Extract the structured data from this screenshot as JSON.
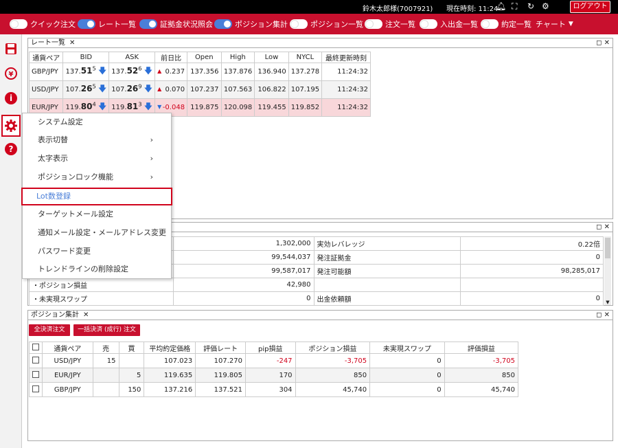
{
  "topbar": {
    "user": "鈴木太郎様(7007921)",
    "time": "現在時刻: 11:24",
    "logout": "ログアウト"
  },
  "menu": [
    {
      "label": "クイック注文",
      "on": false
    },
    {
      "label": "レート一覧",
      "on": true
    },
    {
      "label": "証拠金状況照会",
      "on": true
    },
    {
      "label": "ポジション集計",
      "on": true
    },
    {
      "label": "ポジション一覧",
      "on": false
    },
    {
      "label": "注文一覧",
      "on": false
    },
    {
      "label": "入出金一覧",
      "on": false
    },
    {
      "label": "約定一覧",
      "on": false
    }
  ],
  "chart_menu": "チャート",
  "rate_panel": {
    "title": "レート一覧",
    "headers": [
      "通貨ペア",
      "BID",
      "ASK",
      "前日比",
      "Open",
      "High",
      "Low",
      "NYCL",
      "最終更新時刻"
    ],
    "rows": [
      {
        "pair": "GBP/JPY",
        "bid_pre": "137.",
        "bid_big": "51",
        "bid_sup": "5",
        "ask_pre": "137.",
        "ask_big": "52",
        "ask_sup": "6",
        "change": "0.237",
        "open": "137.356",
        "high": "137.876",
        "low": "136.940",
        "nycl": "137.278",
        "time": "11:24:32"
      },
      {
        "pair": "USD/JPY",
        "bid_pre": "107.",
        "bid_big": "26",
        "bid_sup": "5",
        "ask_pre": "107.",
        "ask_big": "26",
        "ask_sup": "9",
        "change": "0.070",
        "open": "107.237",
        "high": "107.563",
        "low": "106.822",
        "nycl": "107.195",
        "time": "11:24:32"
      },
      {
        "pair": "EUR/JPY",
        "bid_pre": "119.",
        "bid_big": "80",
        "bid_sup": "4",
        "ask_pre": "119.",
        "ask_big": "81",
        "ask_sup": "3",
        "change": "-0.048",
        "open": "119.875",
        "high": "120.098",
        "low": "119.455",
        "nycl": "119.852",
        "time": "11:24:32"
      }
    ]
  },
  "context_menu": {
    "items": [
      {
        "label": "システム設定",
        "sub": false
      },
      {
        "label": "表示切替",
        "sub": true
      },
      {
        "label": "太字表示",
        "sub": true
      },
      {
        "label": "ポジションロック機能",
        "sub": true
      },
      {
        "label": "Lot数登録",
        "sub": false
      },
      {
        "label": "ターゲットメール設定",
        "sub": false
      },
      {
        "label": "通知メール設定・メールアドレス変更",
        "sub": false
      },
      {
        "label": "パスワード変更",
        "sub": false
      },
      {
        "label": "トレンドラインの削除設定",
        "sub": false
      }
    ]
  },
  "account_panel": {
    "rows": [
      {
        "l_label": "",
        "l_val": "1,302,000",
        "r_label": "実効レバレッジ",
        "r_val": "0.22倍"
      },
      {
        "l_label": "",
        "l_val": "99,544,037",
        "r_label": "発注証拠金",
        "r_val": "0"
      },
      {
        "l_label": "",
        "l_val": "99,587,017",
        "r_label": "発注可能額",
        "r_val": "98,285,017"
      },
      {
        "l_label": "・ポジション損益",
        "l_val": "42,980",
        "r_label": "",
        "r_val": ""
      },
      {
        "l_label": "・未実現スワップ",
        "l_val": "0",
        "r_label": "出金依頼額",
        "r_val": "0"
      }
    ]
  },
  "position_panel": {
    "title": "ポジション集計",
    "btn_all": "全決済注文",
    "btn_market": "一括決済 (成行) 注文",
    "headers": [
      "通貨ペア",
      "売",
      "買",
      "平均約定価格",
      "評価レート",
      "pip損益",
      "ポジション損益",
      "未実現スワップ",
      "評価損益"
    ],
    "rows": [
      {
        "pair": "USD/JPY",
        "sell": "15",
        "buy": "",
        "avg": "107.023",
        "rate": "107.270",
        "pip": "-247",
        "pl": "-3,705",
        "swap": "0",
        "eval": "-3,705",
        "neg": true
      },
      {
        "pair": "EUR/JPY",
        "sell": "",
        "buy": "5",
        "avg": "119.635",
        "rate": "119.805",
        "pip": "170",
        "pl": "850",
        "swap": "0",
        "eval": "850",
        "neg": false
      },
      {
        "pair": "GBP/JPY",
        "sell": "",
        "buy": "150",
        "avg": "137.216",
        "rate": "137.521",
        "pip": "304",
        "pl": "45,740",
        "swap": "0",
        "eval": "45,740",
        "neg": false
      }
    ]
  },
  "colors": {
    "brand_red": "#c8102e",
    "toggle_on": "#4a7fd8"
  }
}
